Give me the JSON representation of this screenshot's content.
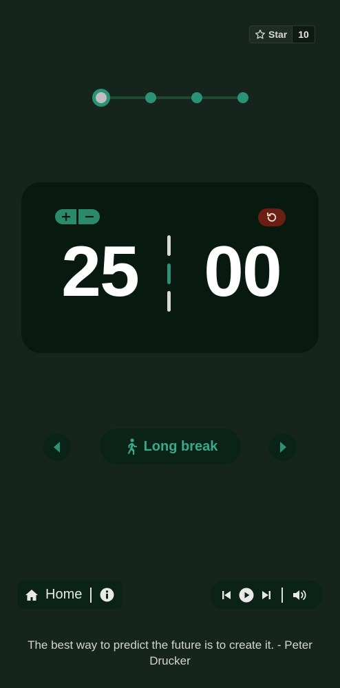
{
  "github": {
    "star_label": "Star",
    "star_count": "10"
  },
  "progress": {
    "total_steps": 4,
    "current_step": 1
  },
  "timer": {
    "minutes": "25",
    "seconds": "00"
  },
  "mode": {
    "label": "Long break",
    "icon": "person-walking-icon"
  },
  "footer": {
    "home_label": "Home"
  },
  "quote": {
    "text": "The best way to predict the future is to create it. - Peter Drucker"
  },
  "colors": {
    "background": "#15241c",
    "card": "#081a10",
    "accent": "#2b9276",
    "reset": "#6b1f12"
  }
}
